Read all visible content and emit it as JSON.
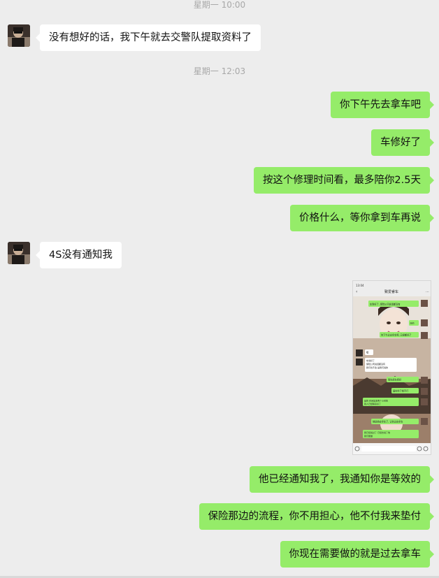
{
  "timestamps": [
    "星期一 10:00",
    "星期一 12:03"
  ],
  "messages": [
    {
      "from": "them",
      "text": "没有想好的话，我下午就去交警队提取资料了"
    },
    {
      "from": "me",
      "text": "你下午先去拿车吧"
    },
    {
      "from": "me",
      "text": "车修好了"
    },
    {
      "from": "me",
      "text": "按这个修理时间看，最多陪你2.5天"
    },
    {
      "from": "me",
      "text": "价格什么，等你拿到车再说"
    },
    {
      "from": "them",
      "text": "4S没有通知我"
    },
    {
      "from": "me",
      "type": "image",
      "description": "chat screenshot image"
    },
    {
      "from": "me",
      "text": "他已经通知我了，我通知你是等效的"
    },
    {
      "from": "me",
      "text": "保险那边的流程，你不用担心，他不付我来垫付"
    },
    {
      "from": "me",
      "text": "你现在需要做的就是过去拿车"
    }
  ],
  "screenshot": {
    "time": "13:04",
    "title": "致爱睿车",
    "caption": "车说好了",
    "lines": [
      "车到好了, 保险公司说话都没有",
      "我们都到了",
      "你下午过去拿车吧, 已经都好了",
      "车已经到了, 保险公司说话都没有说话了, 我们也不会, 是我们说的",
      "我先把车修好",
      "留在你了就不行",
      "是的, 时间最多两个小时的, 别人已经联系好了",
      "他说他去拿车了, 让你过去拿车",
      "我已经说过了, 已经去说了他, 我们能做"
    ]
  },
  "colors": {
    "background": "#ededed",
    "incoming_bubble": "#ffffff",
    "outgoing_bubble": "#95ec69",
    "timestamp_text": "#a8a8a8"
  }
}
